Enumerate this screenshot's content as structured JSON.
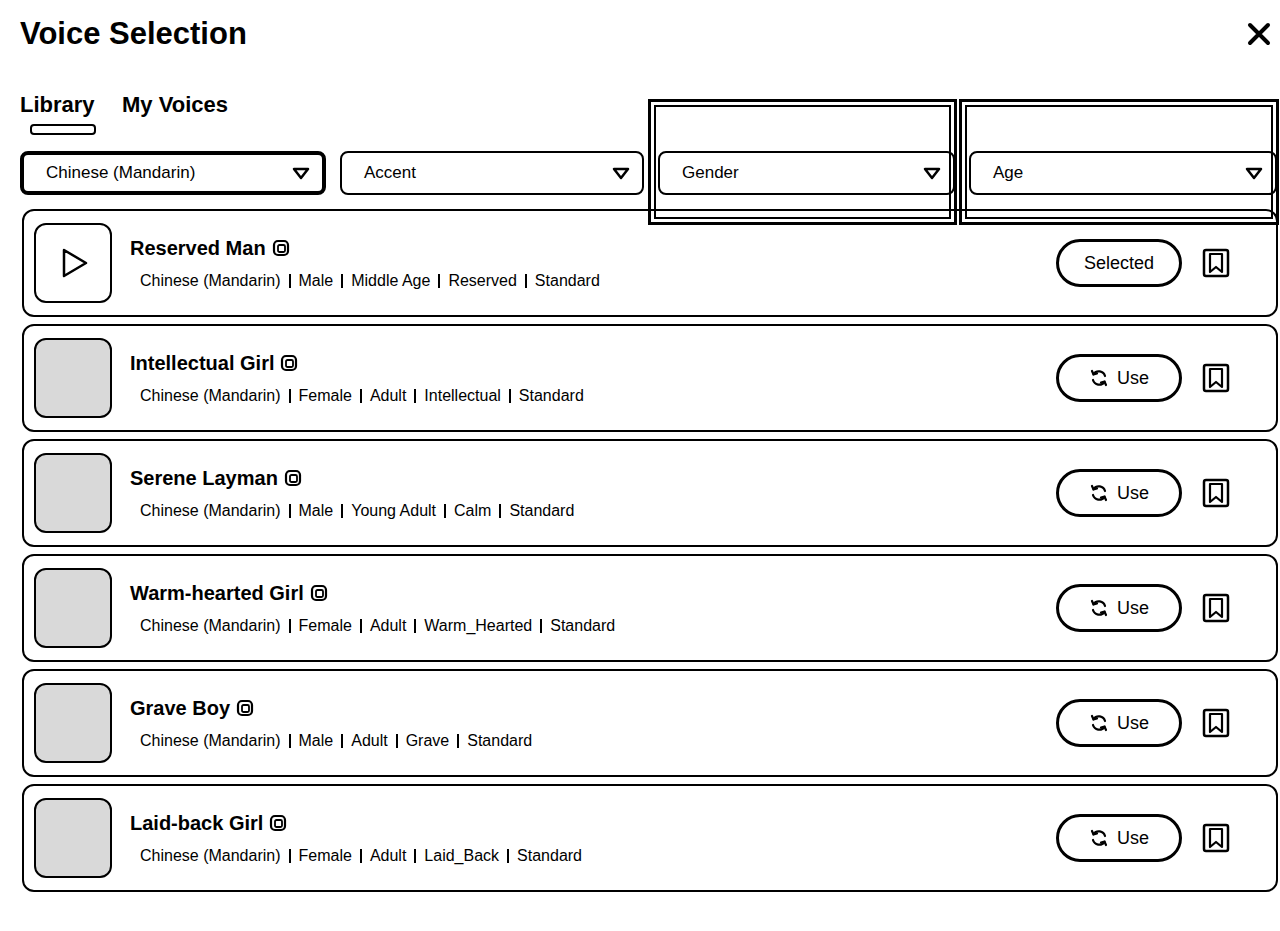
{
  "window": {
    "title": "Voice Selection"
  },
  "tabs": [
    {
      "label": "Library",
      "selected": true
    },
    {
      "label": "My Voices",
      "selected": false
    }
  ],
  "filters": [
    {
      "label": "Chinese (Mandarin)",
      "active": true,
      "highlighted": false
    },
    {
      "label": "Accent",
      "active": false,
      "highlighted": false
    },
    {
      "label": "Gender",
      "active": false,
      "highlighted": true
    },
    {
      "label": "Age",
      "active": false,
      "highlighted": true
    }
  ],
  "voices": [
    {
      "name": "Reserved Man",
      "kind": "play",
      "selected": true,
      "action": "Selected",
      "tags": [
        "Chinese (Mandarin)",
        "Male",
        "Middle Age",
        "Reserved",
        "Standard"
      ]
    },
    {
      "name": "Intellectual Girl",
      "kind": "image",
      "selected": false,
      "action": "Use",
      "tags": [
        "Chinese (Mandarin)",
        "Female",
        "Adult",
        "Intellectual",
        "Standard"
      ]
    },
    {
      "name": "Serene Layman",
      "kind": "image",
      "selected": false,
      "action": "Use",
      "tags": [
        "Chinese (Mandarin)",
        "Male",
        "Young Adult",
        "Calm",
        "Standard"
      ]
    },
    {
      "name": "Warm-hearted Girl",
      "kind": "image",
      "selected": false,
      "action": "Use",
      "tags": [
        "Chinese (Mandarin)",
        "Female",
        "Adult",
        "Warm_Hearted",
        "Standard"
      ]
    },
    {
      "name": "Grave Boy",
      "kind": "image",
      "selected": false,
      "action": "Use",
      "tags": [
        "Chinese (Mandarin)",
        "Male",
        "Adult",
        "Grave",
        "Standard"
      ]
    },
    {
      "name": "Laid-back Girl",
      "kind": "image",
      "selected": false,
      "action": "Use",
      "tags": [
        "Chinese (Mandarin)",
        "Female",
        "Adult",
        "Laid_Back",
        "Standard"
      ]
    }
  ]
}
